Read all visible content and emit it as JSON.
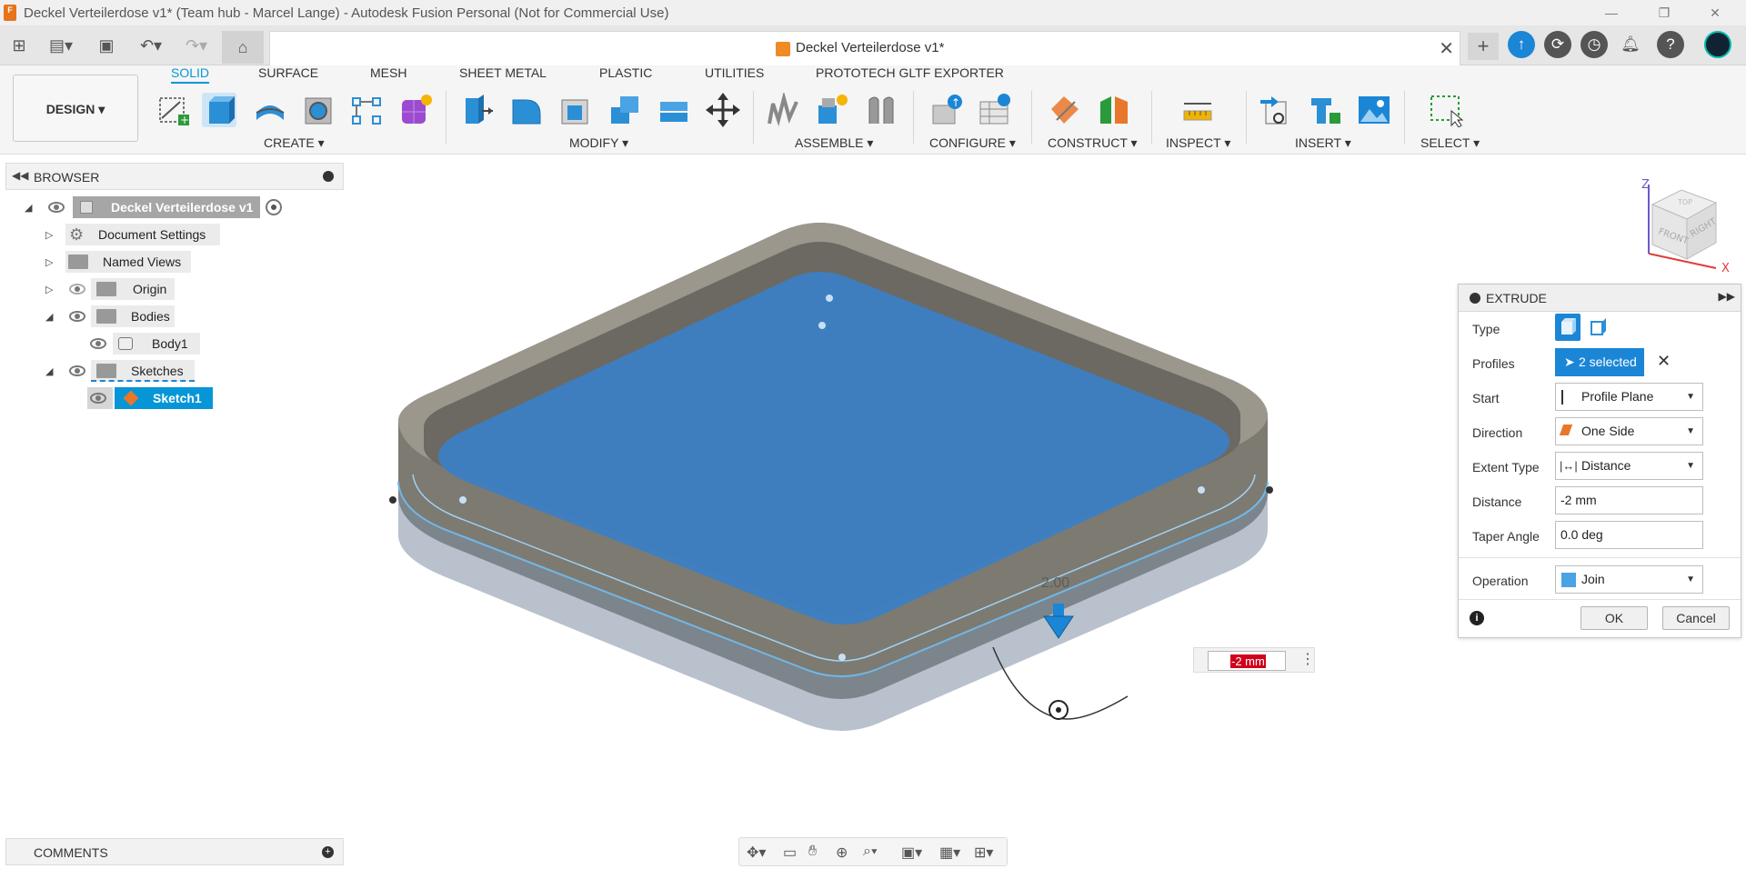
{
  "window": {
    "title": "Deckel Verteilerdose v1* (Team hub - Marcel Lange) - Autodesk Fusion Personal (Not for Commercial Use)",
    "app_icon_label": "F"
  },
  "document_tab": {
    "label": "Deckel Verteilerdose v1*"
  },
  "ribbon": {
    "workspace": "DESIGN",
    "tabs": [
      "SOLID",
      "SURFACE",
      "MESH",
      "SHEET METAL",
      "PLASTIC",
      "UTILITIES",
      "PROTOTECH GLTF EXPORTER"
    ],
    "active_tab": "SOLID",
    "groups": [
      "CREATE ▾",
      "MODIFY ▾",
      "ASSEMBLE ▾",
      "CONFIGURE ▾",
      "CONSTRUCT ▾",
      "INSPECT ▾",
      "INSERT ▾",
      "SELECT ▾"
    ]
  },
  "browser": {
    "title": "BROWSER",
    "root": "Deckel Verteilerdose v1",
    "items": [
      "Document Settings",
      "Named Views",
      "Origin",
      "Bodies",
      "Body1",
      "Sketches",
      "Sketch1"
    ]
  },
  "extrude": {
    "title": "EXTRUDE",
    "type_label": "Type",
    "profiles_label": "Profiles",
    "profiles_value": "2 selected",
    "start_label": "Start",
    "start_value": "Profile Plane",
    "direction_label": "Direction",
    "direction_value": "One Side",
    "extent_label": "Extent Type",
    "extent_value": "Distance",
    "distance_label": "Distance",
    "distance_value": "-2 mm",
    "taper_label": "Taper Angle",
    "taper_value": "0.0 deg",
    "operation_label": "Operation",
    "operation_value": "Join",
    "ok": "OK",
    "cancel": "Cancel"
  },
  "viewport": {
    "dimension_label": "2.00",
    "distance_input": "-2 mm"
  },
  "viewcube": {
    "front": "FRONT",
    "right": "RIGHT",
    "top": "TOP",
    "axis_z": "Z",
    "axis_x": "X"
  },
  "comments": {
    "title": "COMMENTS"
  },
  "colors": {
    "accent": "#0696d7",
    "selection_fill": "#3c7fc4",
    "body": "#7a776f"
  }
}
